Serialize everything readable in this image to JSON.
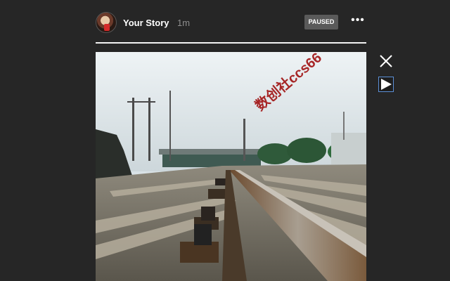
{
  "story": {
    "username": "Your Story",
    "time_ago": "1m",
    "status_badge": "PAUSED",
    "more_icon": "ellipsis-icon",
    "progress": 1.0
  },
  "controls": {
    "close_icon": "close-icon",
    "play_icon": "play-icon"
  },
  "media": {
    "watermark_text": "数创社ccs66"
  },
  "colors": {
    "background": "#262626",
    "badge": "#5a5a5a",
    "accent_play_border": "#5b8fd6",
    "watermark": "#a01010"
  }
}
